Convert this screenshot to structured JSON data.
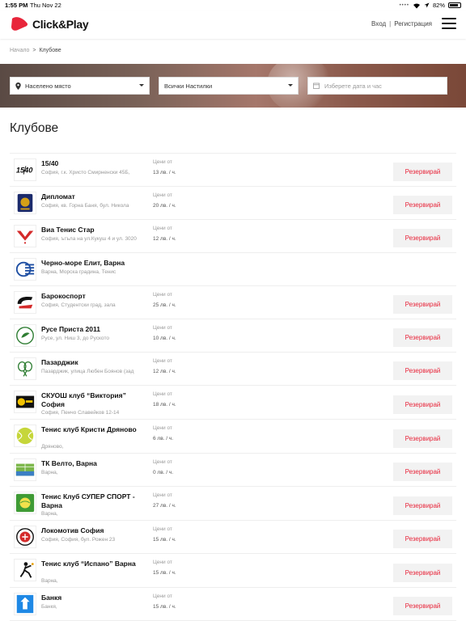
{
  "status_bar": {
    "time": "1:55 PM",
    "date": "Thu Nov 22",
    "battery": "82%"
  },
  "header": {
    "brand": "Click&Play",
    "login": "Вход",
    "separator": "|",
    "register": "Регистрация"
  },
  "breadcrumb": {
    "home": "Начало",
    "current": "Клубове"
  },
  "filters": {
    "city": "Населено място",
    "surface": "Всички Настилки",
    "date_placeholder": "Изберете дата и час"
  },
  "page_title": "Клубове",
  "book_label": "Резервирай",
  "price_label": "Цени от",
  "colors": {
    "accent": "#e8263b",
    "hero": "#8b5a4c"
  },
  "clubs": [
    {
      "name": "15/40",
      "address": "София, г.к. Христо Смирненски 45Б,",
      "price": "13 лв. / ч.",
      "logo": "1540-logo"
    },
    {
      "name": "Дипломат",
      "address": "София, кв. Горна Баня, бул. Никола",
      "price": "20 лв. / ч.",
      "logo": "diplomat-crest-logo"
    },
    {
      "name": "Виа Тенис Стар",
      "address": "София, ъгъла на ул.Кукуш 4 и ул. 3020",
      "price": "12 лв. / ч.",
      "logo": "via-tennis-star-logo"
    },
    {
      "name": "Черно-море Елит, Варна",
      "address": "Варна, Морска градина, Тенис",
      "price": "",
      "logo": "cherno-more-logo"
    },
    {
      "name": "Барокоспорт",
      "address": "София, Студентски град, зала",
      "price": "25 лв. / ч.",
      "logo": "barokosport-logo"
    },
    {
      "name": "Русе Приста 2011",
      "address": "Русе, ул. Ниш 3, до Рускoто",
      "price": "10 лв. / ч.",
      "logo": "ruse-prista-logo"
    },
    {
      "name": "Пазарджик",
      "address": "Пазарджик, улица Любен Боянов (зад",
      "price": "12 лв. / ч.",
      "logo": "pazardzhik-rackets-logo"
    },
    {
      "name": "СКУОШ клуб “Виктория” София",
      "address": "София, Пенчо Славейков 12-14",
      "price": "18 лв. / ч.",
      "logo": "victoria-squash-logo"
    },
    {
      "name": "Тенис клуб Кристи Дряново",
      "address": "Дряново,",
      "price": "6 лв. / ч.",
      "logo": "kristi-ball-logo"
    },
    {
      "name": "ТК Велто, Варна",
      "address": "Варна,",
      "price": "0 лв. / ч.",
      "logo": "velto-court-logo"
    },
    {
      "name": "Тенис Клуб СУПЕР СПОРТ - Варна",
      "address": "Варна,",
      "price": "27 лв. / ч.",
      "logo": "super-sport-logo"
    },
    {
      "name": "Локомотив София",
      "address": "София, София, бул. Рожен 23",
      "price": "15 лв. / ч.",
      "logo": "lokomotiv-crest-logo"
    },
    {
      "name": "Тенис клуб “Испано” Варна",
      "address": "Варна,",
      "price": "15 лв. / ч.",
      "logo": "ispano-player-logo"
    },
    {
      "name": "Банкя",
      "address": "Банкя,",
      "price": "15 лв. / ч.",
      "logo": "bankya-logo"
    }
  ]
}
